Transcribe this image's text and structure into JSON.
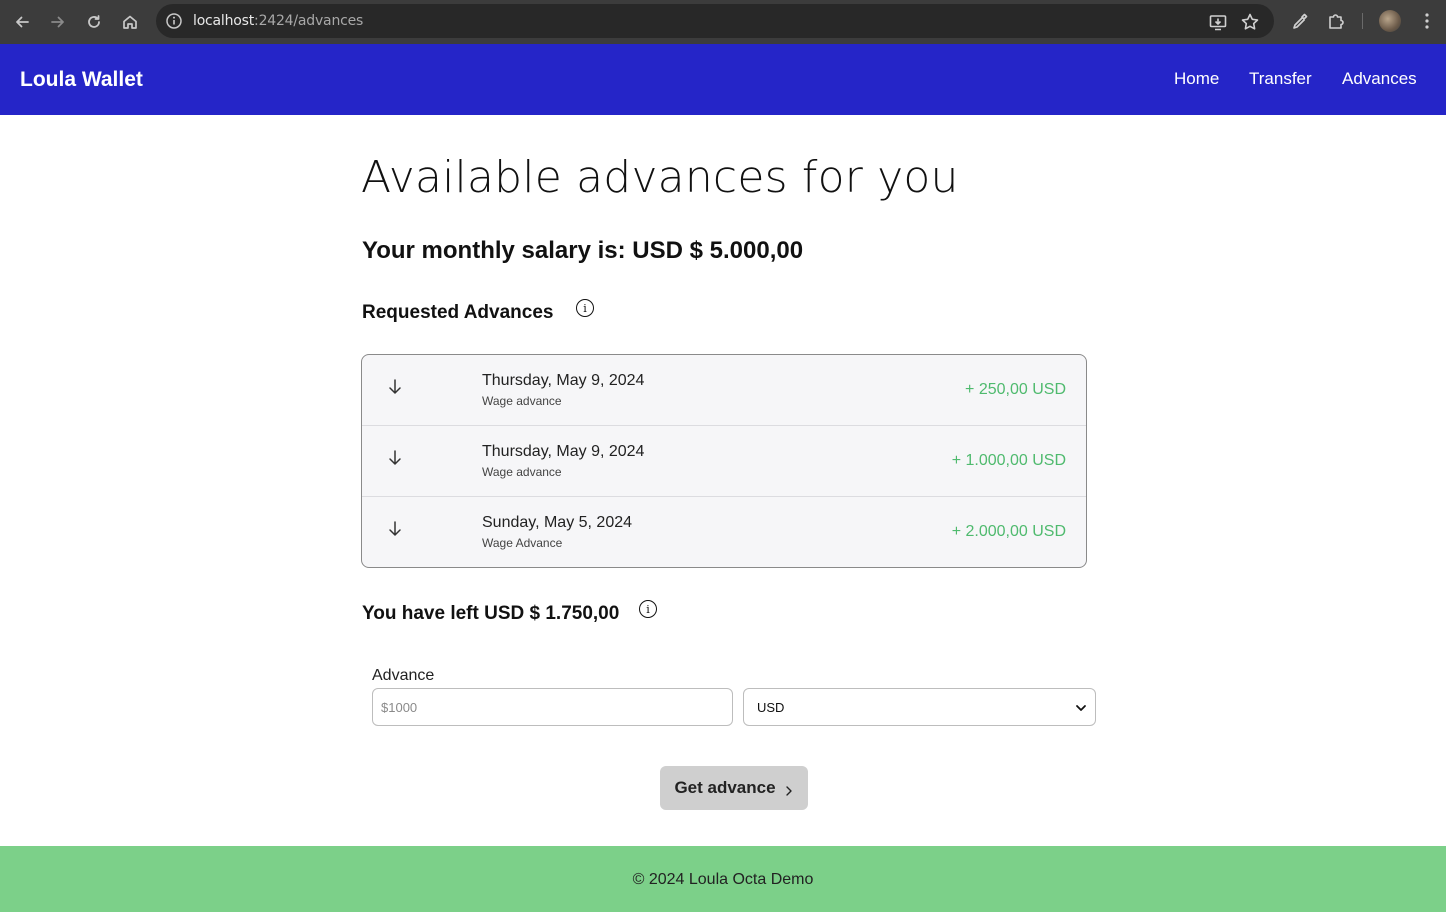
{
  "browser": {
    "url_host": "localhost",
    "url_path": ":2424/advances"
  },
  "header": {
    "brand": "Loula Wallet",
    "nav": [
      "Home",
      "Transfer",
      "Advances"
    ]
  },
  "main": {
    "title": "Available advances for you",
    "salary": "Your monthly salary is: USD $ 5.000,00",
    "requested_title": "Requested Advances",
    "advances": [
      {
        "date": "Thursday, May 9, 2024",
        "desc": "Wage advance",
        "amount": "+ 250,00 USD"
      },
      {
        "date": "Thursday, May 9, 2024",
        "desc": "Wage advance",
        "amount": "+ 1.000,00 USD"
      },
      {
        "date": "Sunday, May 5, 2024",
        "desc": "Wage Advance",
        "amount": "+ 2.000,00 USD"
      }
    ],
    "left_text": "You have left USD $ 1.750,00",
    "form": {
      "label": "Advance",
      "placeholder": "$1000",
      "currency": "USD",
      "button": "Get advance"
    }
  },
  "footer": {
    "text": "© 2024 Loula Octa Demo"
  },
  "colors": {
    "brand_blue": "#2525c8",
    "footer_green": "#7cd089",
    "amount_green": "#4fba6e"
  }
}
